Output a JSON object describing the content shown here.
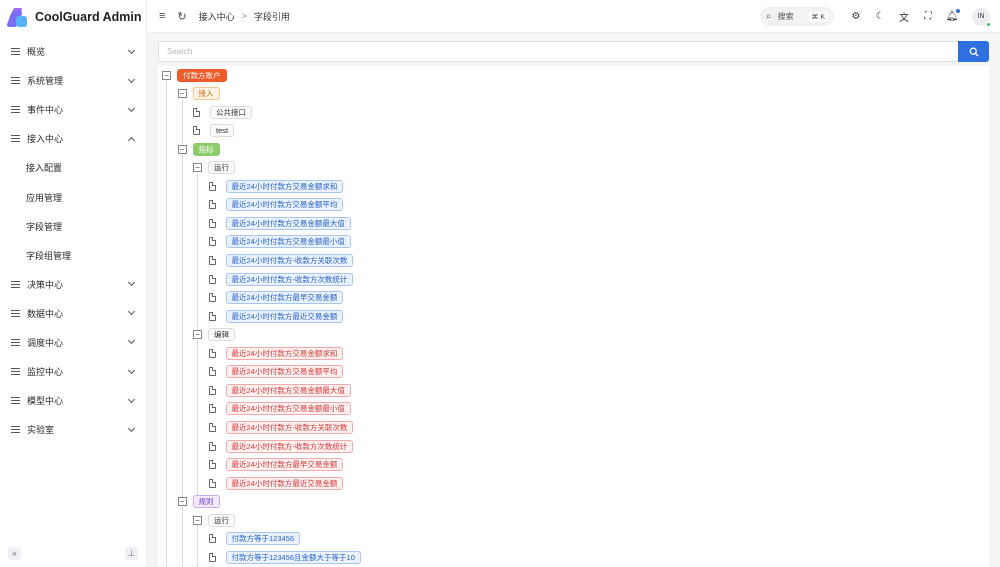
{
  "app": {
    "name": "CoolGuard Admin"
  },
  "sidebar": {
    "items": [
      {
        "label": "概览",
        "type": "group",
        "expanded": false
      },
      {
        "label": "系统管理",
        "type": "group",
        "expanded": false
      },
      {
        "label": "事件中心",
        "type": "group",
        "expanded": false
      },
      {
        "label": "接入中心",
        "type": "group",
        "expanded": true
      },
      {
        "label": "接入配置",
        "type": "sub"
      },
      {
        "label": "应用管理",
        "type": "sub"
      },
      {
        "label": "字段管理",
        "type": "sub"
      },
      {
        "label": "字段组管理",
        "type": "sub"
      },
      {
        "label": "决策中心",
        "type": "group",
        "expanded": false
      },
      {
        "label": "数据中心",
        "type": "group",
        "expanded": false
      },
      {
        "label": "调度中心",
        "type": "group",
        "expanded": false
      },
      {
        "label": "监控中心",
        "type": "group",
        "expanded": false
      },
      {
        "label": "模型中心",
        "type": "group",
        "expanded": false
      },
      {
        "label": "实验室",
        "type": "group",
        "expanded": false
      }
    ],
    "footer": {
      "collapse_glyph": "«",
      "pin_glyph": "⊥"
    }
  },
  "header": {
    "breadcrumb": [
      "接入中心",
      "字段引用"
    ],
    "breadcrumb_sep": ">",
    "search_label": "搜索",
    "search_shortcut": "⌘ K",
    "avatar_initials": "IN"
  },
  "content": {
    "search_placeholder": "Search",
    "tree": {
      "root": "付款方账户",
      "access": {
        "label": "接入",
        "children": [
          "公共接口",
          "test"
        ]
      },
      "metric": {
        "label": "指标",
        "running": {
          "label": "运行",
          "children": [
            "最近24小时付款方交易金额求和",
            "最近24小时付款方交易金额平均",
            "最近24小时付款方交易金额最大值",
            "最近24小时付款方交易金额最小值",
            "最近24小时付款方-收款方关联次数",
            "最近24小时付款方-收款方次数统计",
            "最近24小时付款方最早交易金额",
            "最近24小时付款方最近交易金额"
          ]
        },
        "editing": {
          "label": "编辑",
          "children": [
            "最近24小时付款方交易金额求和",
            "最近24小时付款方交易金额平均",
            "最近24小时付款方交易金额最大值",
            "最近24小时付款方交易金额最小值",
            "最近24小时付款方-收款方关联次数",
            "最近24小时付款方-收款方次数统计",
            "最近24小时付款方最早交易金额",
            "最近24小时付款方最近交易金额"
          ]
        }
      },
      "rule": {
        "label": "规则",
        "running": {
          "label": "运行",
          "children": [
            "付款方等于123456",
            "付款方等于123456且金额大于等于10"
          ]
        }
      }
    }
  },
  "colors": {
    "primary": "#2f6fe0",
    "root_tag": "#ef5a29",
    "metric_tag": "#8dcc6b",
    "running_blue": "#2a62c7",
    "editing_red": "#d2393a",
    "rule_purple": "#7340c9"
  }
}
